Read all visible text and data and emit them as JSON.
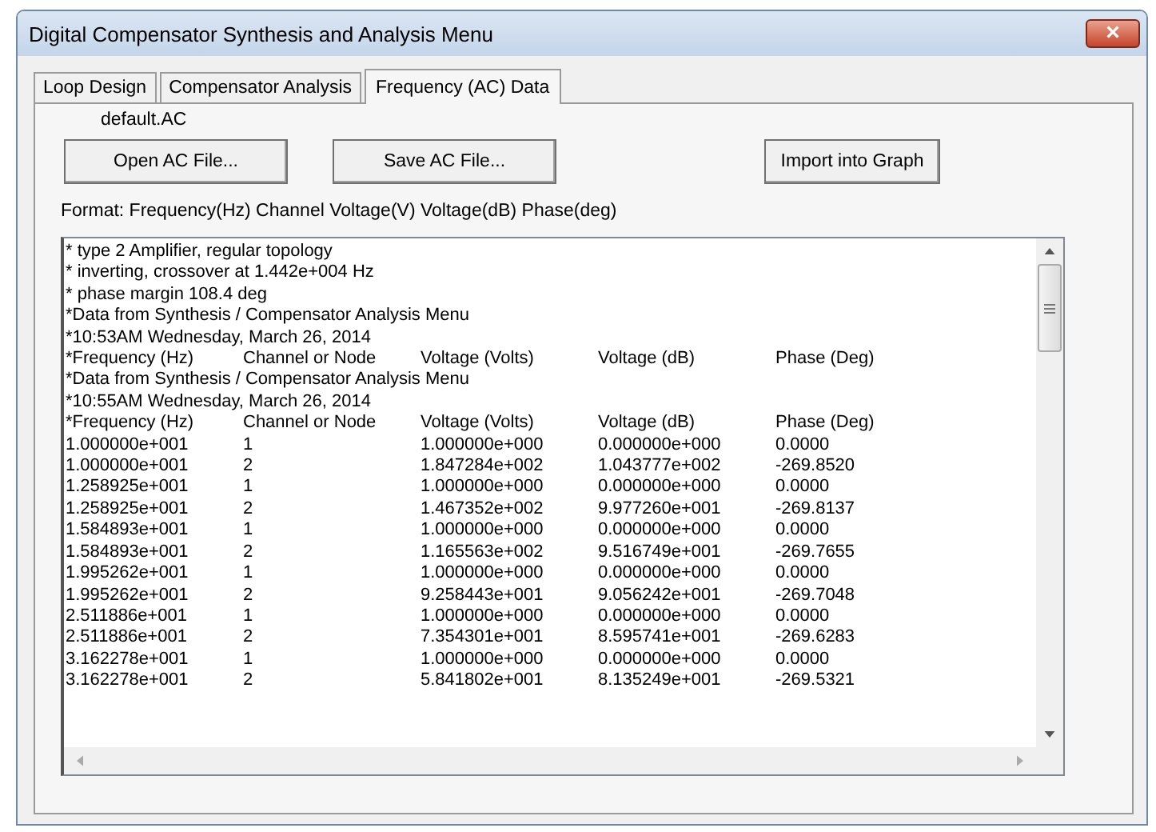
{
  "window": {
    "title": "Digital Compensator Synthesis and Analysis Menu",
    "close": "×"
  },
  "tabs": [
    {
      "label": "Loop Design",
      "selected": false
    },
    {
      "label": "Compensator Analysis",
      "selected": false
    },
    {
      "label": "Frequency (AC) Data",
      "selected": true
    }
  ],
  "file_name": "default.AC",
  "buttons": [
    {
      "label": "Open AC File..."
    },
    {
      "label": "Save AC File..."
    },
    {
      "label": "Import into Graph"
    }
  ],
  "format_label": "Format:  Frequency(Hz)  Channel  Voltage(V)  Voltage(dB)  Phase(deg)",
  "text_area": {
    "lines": [
      {
        "kind": "comment",
        "text": "* type 2 Amplifier, regular topology"
      },
      {
        "kind": "comment",
        "text": "* inverting, crossover at 1.442e+004 Hz"
      },
      {
        "kind": "comment",
        "text": "* phase margin 108.4 deg"
      },
      {
        "kind": "comment",
        "text": "*Data from Synthesis / Compensator Analysis Menu"
      },
      {
        "kind": "comment",
        "text": "*10:53AM Wednesday, March 26, 2014"
      },
      {
        "kind": "columns",
        "cells": [
          "*Frequency (Hz)",
          "Channel or Node",
          "Voltage (Volts)",
          "Voltage (dB)",
          "Phase (Deg)"
        ]
      },
      {
        "kind": "comment",
        "text": "*Data from Synthesis / Compensator Analysis Menu"
      },
      {
        "kind": "comment",
        "text": "*10:55AM Wednesday, March 26, 2014"
      },
      {
        "kind": "columns",
        "cells": [
          "*Frequency (Hz)",
          "Channel or Node",
          "Voltage (Volts)",
          "Voltage (dB)",
          "Phase (Deg)"
        ]
      },
      {
        "kind": "columns",
        "cells": [
          "1.000000e+001",
          "1",
          "1.000000e+000",
          "0.000000e+000",
          "0.0000"
        ]
      },
      {
        "kind": "columns",
        "cells": [
          "1.000000e+001",
          "2",
          "1.847284e+002",
          "1.043777e+002",
          "-269.8520"
        ]
      },
      {
        "kind": "columns",
        "cells": [
          "1.258925e+001",
          "1",
          "1.000000e+000",
          "0.000000e+000",
          "0.0000"
        ]
      },
      {
        "kind": "columns",
        "cells": [
          "1.258925e+001",
          "2",
          "1.467352e+002",
          "9.977260e+001",
          "-269.8137"
        ]
      },
      {
        "kind": "columns",
        "cells": [
          "1.584893e+001",
          "1",
          "1.000000e+000",
          "0.000000e+000",
          "0.0000"
        ]
      },
      {
        "kind": "columns",
        "cells": [
          "1.584893e+001",
          "2",
          "1.165563e+002",
          "9.516749e+001",
          "-269.7655"
        ]
      },
      {
        "kind": "columns",
        "cells": [
          "1.995262e+001",
          "1",
          "1.000000e+000",
          "0.000000e+000",
          "0.0000"
        ]
      },
      {
        "kind": "columns",
        "cells": [
          "1.995262e+001",
          "2",
          "9.258443e+001",
          "9.056242e+001",
          "-269.7048"
        ]
      },
      {
        "kind": "columns",
        "cells": [
          "2.511886e+001",
          "1",
          "1.000000e+000",
          "0.000000e+000",
          "0.0000"
        ]
      },
      {
        "kind": "columns",
        "cells": [
          "2.511886e+001",
          "2",
          "7.354301e+001",
          "8.595741e+001",
          "-269.6283"
        ]
      },
      {
        "kind": "columns",
        "cells": [
          "3.162278e+001",
          "1",
          "1.000000e+000",
          "0.000000e+000",
          "0.0000"
        ]
      },
      {
        "kind": "columns",
        "cells": [
          "3.162278e+001",
          "2",
          "5.841802e+001",
          "8.135249e+001",
          "-269.5321"
        ]
      }
    ]
  }
}
